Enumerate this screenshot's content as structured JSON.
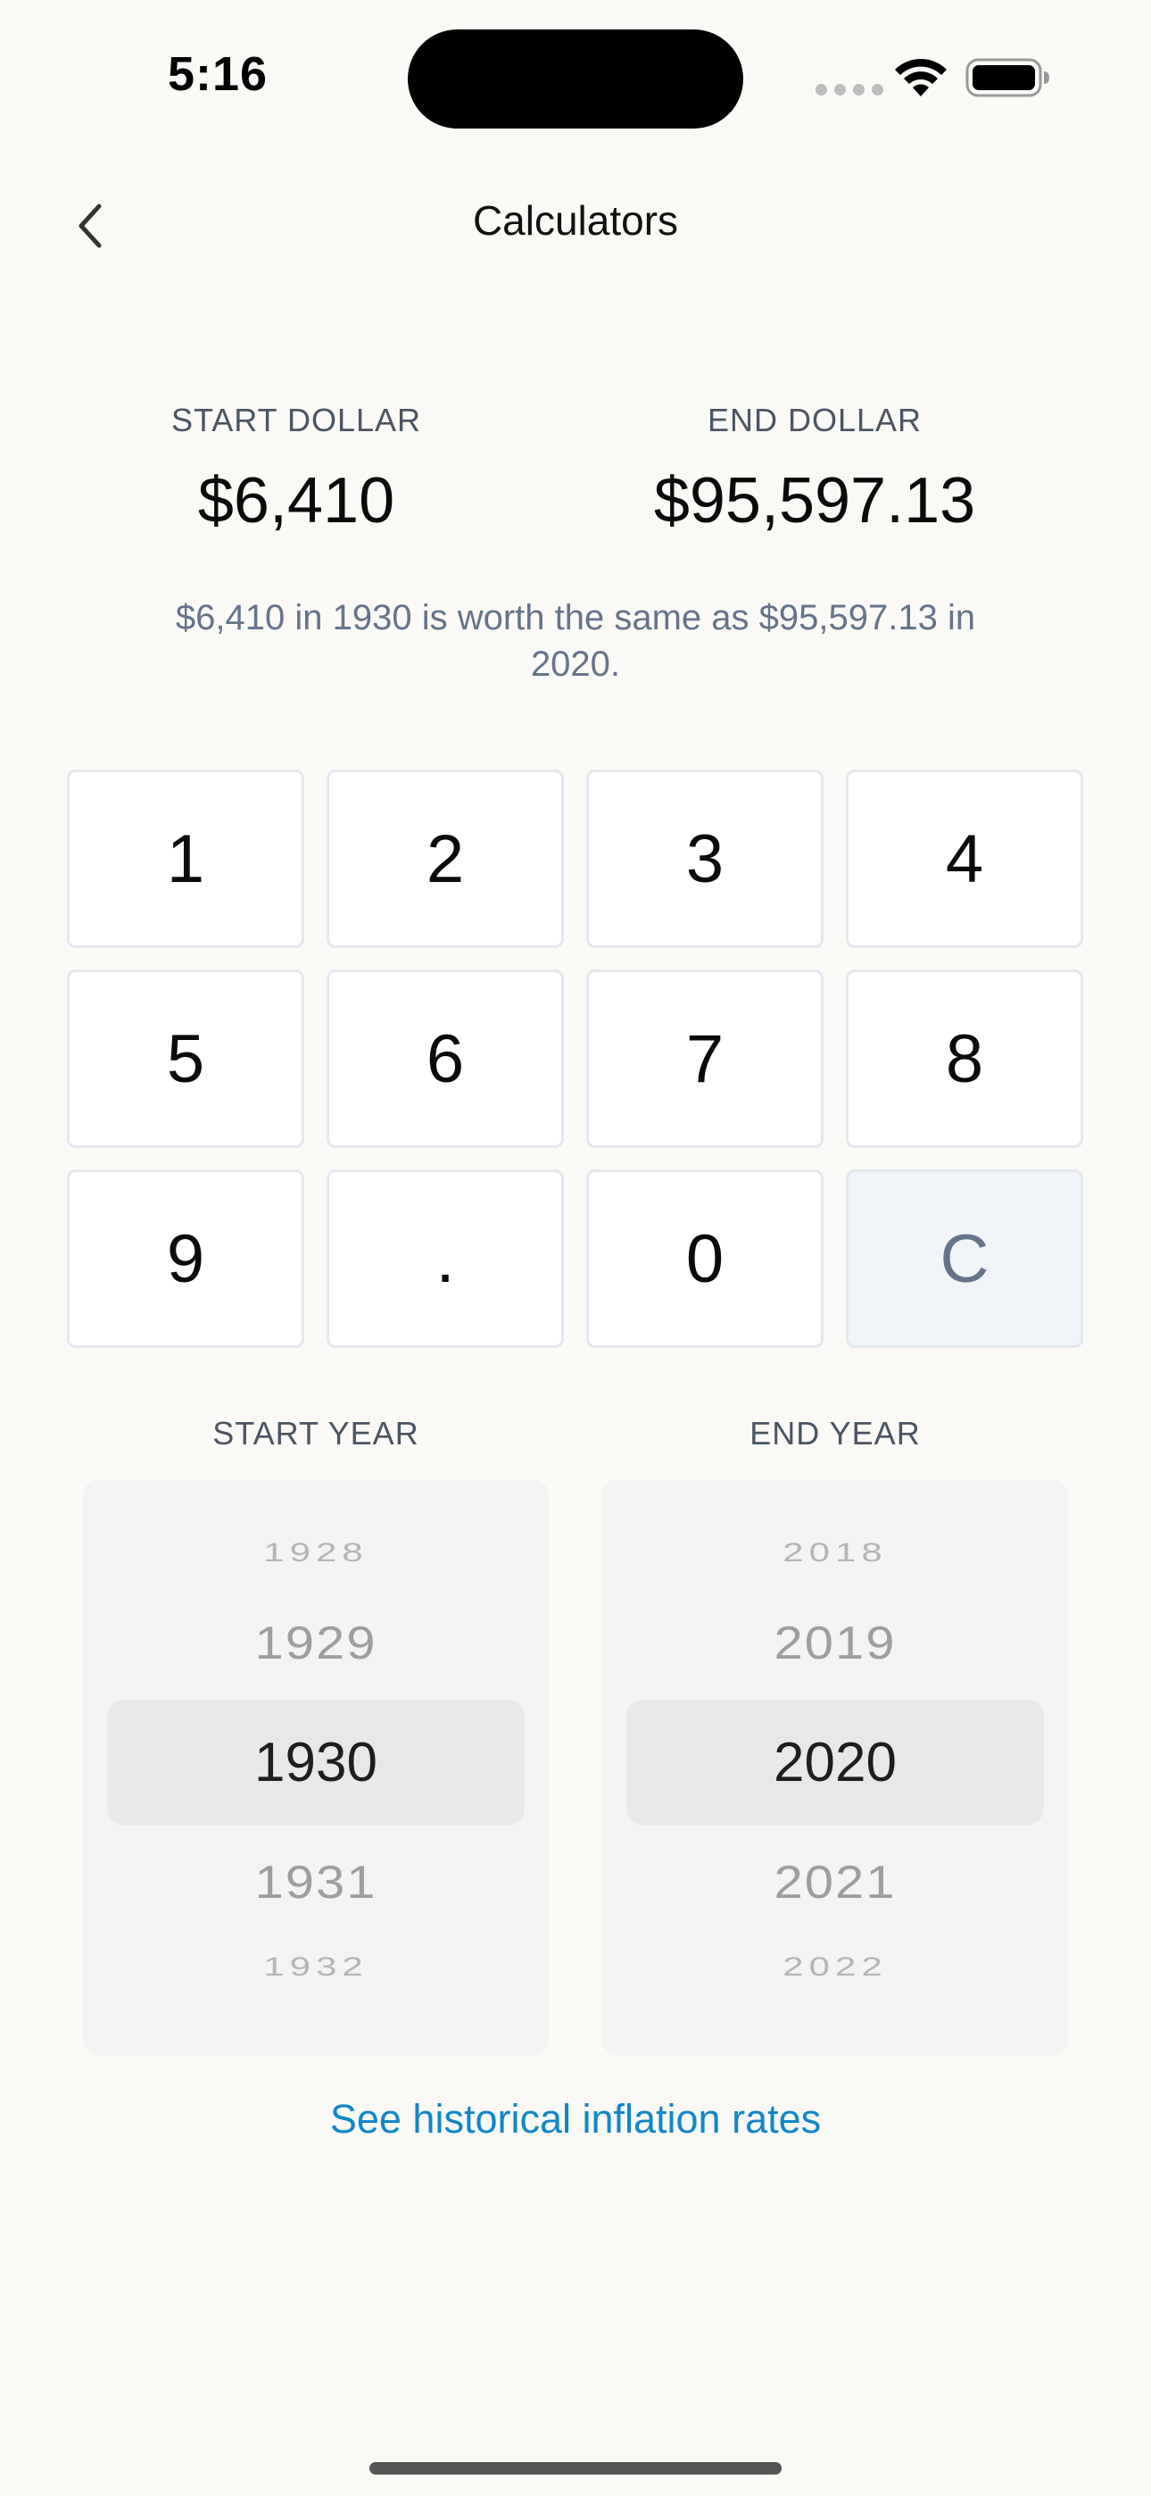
{
  "status_bar": {
    "time": "5:16",
    "icons": [
      "cellular-signal-icon",
      "wifi-icon",
      "battery-icon"
    ]
  },
  "nav": {
    "title": "Calculators",
    "back_icon": "chevron-left-icon"
  },
  "start_dollar": {
    "label": "START DOLLAR",
    "value": "$6,410"
  },
  "end_dollar": {
    "label": "END DOLLAR",
    "value": "$95,597.13"
  },
  "summary": "$6,410 in 1930 is worth the same as $95,597.13 in 2020.",
  "keypad": {
    "keys": [
      "1",
      "2",
      "3",
      "4",
      "5",
      "6",
      "7",
      "8",
      "9",
      ".",
      "0",
      "C"
    ]
  },
  "start_year": {
    "label": "START YEAR",
    "options": [
      "1928",
      "1929",
      "1930",
      "1931",
      "1932"
    ],
    "selected": "1930"
  },
  "end_year": {
    "label": "END YEAR",
    "options": [
      "2018",
      "2019",
      "2020",
      "2021",
      "2022"
    ],
    "selected": "2020"
  },
  "history_link": "See historical inflation rates",
  "colors": {
    "background": "#FAF9F5",
    "link": "#1187C8",
    "muted_text": "#66748A",
    "key_border": "#E3E7EE",
    "clear_key_bg": "#F0F3F8"
  }
}
